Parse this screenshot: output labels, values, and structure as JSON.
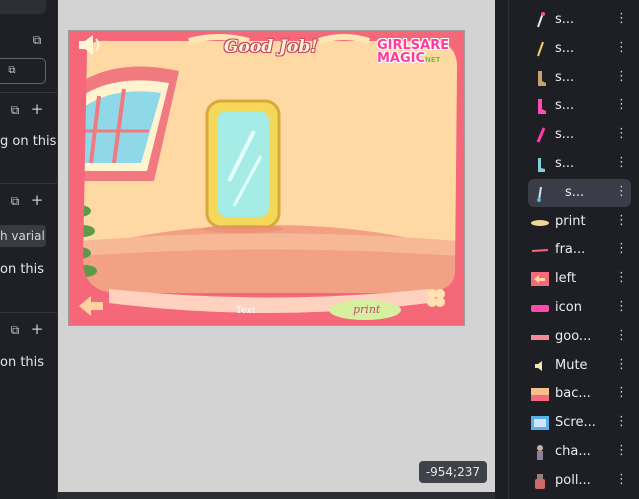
{
  "left_panel": {
    "rows": [
      {
        "text": "g on this"
      },
      {
        "chip": "h varial"
      },
      {
        "text": "on this"
      },
      {
        "text": "on this"
      }
    ],
    "icons": [
      "external-link-icon",
      "plus-icon"
    ]
  },
  "canvas": {
    "coordinate_readout": "-954;237",
    "game": {
      "title": "Good Job!",
      "brand_line1": "GIRLSARE",
      "brand_line2": "MAGIC",
      "brand_suffix": "NET",
      "text_label": "Text",
      "print_label": "print"
    }
  },
  "layers": [
    {
      "name": "s...",
      "thumb": "brush-pink-icon"
    },
    {
      "name": "s...",
      "thumb": "brush-yellow-icon"
    },
    {
      "name": "s...",
      "thumb": "boot-brown-icon"
    },
    {
      "name": "s...",
      "thumb": "boot-pink-icon"
    },
    {
      "name": "s...",
      "thumb": "lipstick-pink-icon"
    },
    {
      "name": "s...",
      "thumb": "boot-teal-icon"
    },
    {
      "name": "s...",
      "thumb": "brush-teal-icon"
    },
    {
      "name": "print",
      "thumb": "print-banner-icon"
    },
    {
      "name": "fra...",
      "thumb": "frame-line-icon"
    },
    {
      "name": "left",
      "thumb": "left-arrow-icon"
    },
    {
      "name": "icon",
      "thumb": "icon-bar-icon"
    },
    {
      "name": "goo...",
      "thumb": "good-job-icon"
    },
    {
      "name": "Mute",
      "thumb": "speaker-icon"
    },
    {
      "name": "bac...",
      "thumb": "background-icon"
    },
    {
      "name": "Scre...",
      "thumb": "screen-icon"
    },
    {
      "name": "cha...",
      "thumb": "character-icon"
    },
    {
      "name": "poll...",
      "thumb": "polish-icon"
    }
  ],
  "selected_layer_index": 6,
  "colors": {
    "stage_border_pink": "#f4687a",
    "wall": "#ffd9a4",
    "floor": "#f3a185",
    "mirror_frame": "#f4d85a",
    "mirror_glass": "#a6ece6",
    "accent_green": "#d6f0a0"
  }
}
